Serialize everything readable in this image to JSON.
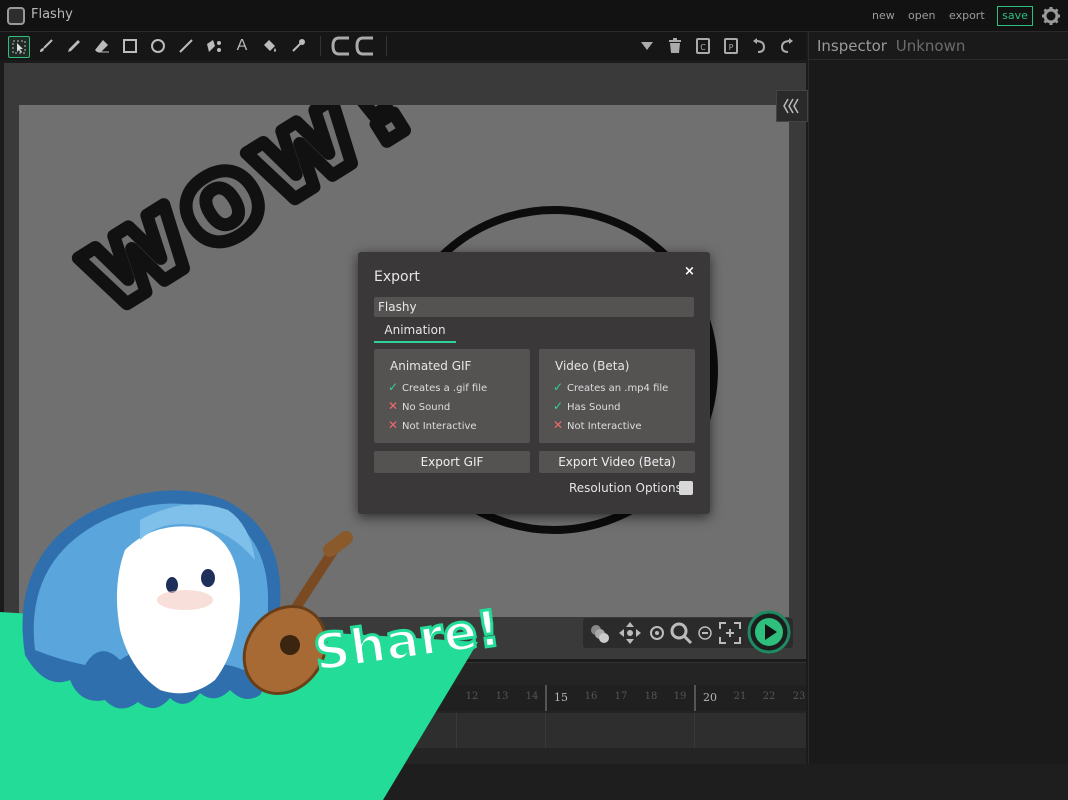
{
  "app": {
    "title": "Flashy"
  },
  "menu": {
    "new": "new",
    "open": "open",
    "export": "export",
    "save": "save"
  },
  "inspector": {
    "title": "Inspector",
    "subtitle": "Unknown"
  },
  "canvas_text": "wow!",
  "timeline": {
    "frames": [
      "12",
      "13",
      "14",
      "15",
      "16",
      "17",
      "18",
      "19",
      "20",
      "21",
      "22",
      "23"
    ]
  },
  "export_dialog": {
    "title": "Export",
    "close": "×",
    "name_value": "Flashy",
    "tab": "Animation",
    "gif": {
      "title": "Animated GIF",
      "features": [
        {
          "mark": "✓",
          "text": "Creates a .gif file"
        },
        {
          "mark": "✕",
          "text": "No Sound"
        },
        {
          "mark": "✕",
          "text": "Not Interactive"
        }
      ],
      "button": "Export GIF"
    },
    "video": {
      "title": "Video (Beta)",
      "features": [
        {
          "mark": "✓",
          "text": "Creates an .mp4 file"
        },
        {
          "mark": "✓",
          "text": "Has Sound"
        },
        {
          "mark": "✕",
          "text": "Not Interactive"
        }
      ],
      "button": "Export Video (Beta)"
    },
    "resolution_label": "Resolution Options"
  },
  "promo": {
    "text": "Share!"
  },
  "colors": {
    "accent": "#2fbf7c",
    "promo_green": "#22dc98",
    "check": "#2fd39a",
    "cross": "#f06a6a"
  }
}
